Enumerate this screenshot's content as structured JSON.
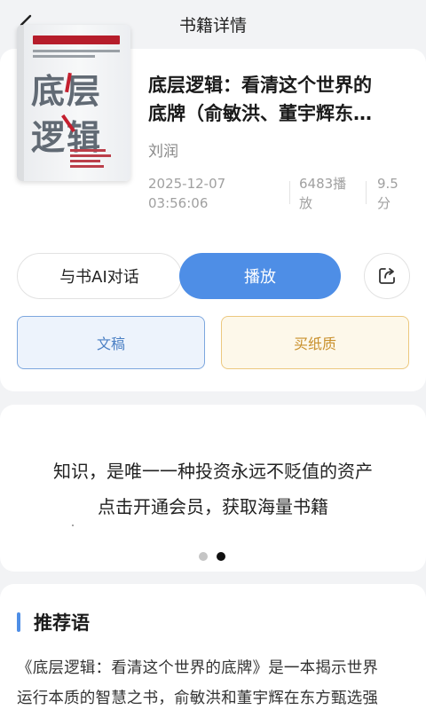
{
  "header": {
    "title": "书籍详情",
    "back_icon": "chevron-left-icon"
  },
  "book": {
    "cover_lines": [
      "底层",
      "逻辑"
    ],
    "title_line1": "底层逻辑：看清这个世界的",
    "title_line2": "底牌（俞敏洪、董宇辉东…",
    "author": "刘润",
    "date": "2025-12-07",
    "time": "03:56:06",
    "plays_line1": "6483播",
    "plays_line2": "放",
    "score_line1": "9.5",
    "score_line2": "分"
  },
  "actions": {
    "ai_chat": "与书AI对话",
    "play": "播放",
    "share_icon": "share-icon",
    "draft": "文稿",
    "buy_paper": "买纸质"
  },
  "banner": {
    "line1": "知识，是唯一一种投资永远不贬值的资产",
    "line2": "点击开通会员，获取海量书籍",
    "page_count": 2,
    "active_page": 2
  },
  "recommendation": {
    "heading": "推荐语",
    "line1": "《底层逻辑：看清这个世界的底牌》是一本揭示世界",
    "line2": "运行本质的智慧之书，俞敏洪和董宇辉在东方甄选强"
  },
  "colors": {
    "accent": "#4e8ee6",
    "draft_border": "#7da7de",
    "paper_border": "#ecc87f",
    "background": "#f2f3f5"
  }
}
